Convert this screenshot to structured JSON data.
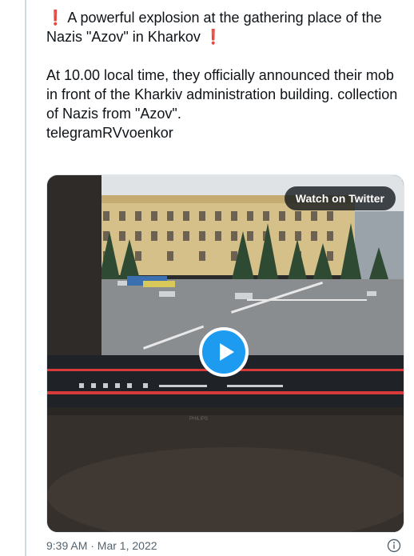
{
  "tweet": {
    "line1_prefix": "❗",
    "headline": " A powerful explosion at the gathering place of the Nazis \"Azov\" in Kharkov ",
    "line1_suffix": "❗",
    "body": "At 10.00 local time, they officially announced their mob in front of the Kharkiv administration building.  collection of Nazis from \"Azov\".",
    "source": "telegramRVvoenkor"
  },
  "media": {
    "watch_label": "Watch on Twitter",
    "icons": {
      "play": "play-icon"
    }
  },
  "footer": {
    "timestamp": "9:39 AM · Mar 1, 2022",
    "info_icon": "info-icon"
  },
  "colors": {
    "accent": "#1d9bf0",
    "text": "#0f1419",
    "muted": "#536471",
    "alert": "#e0245e"
  }
}
